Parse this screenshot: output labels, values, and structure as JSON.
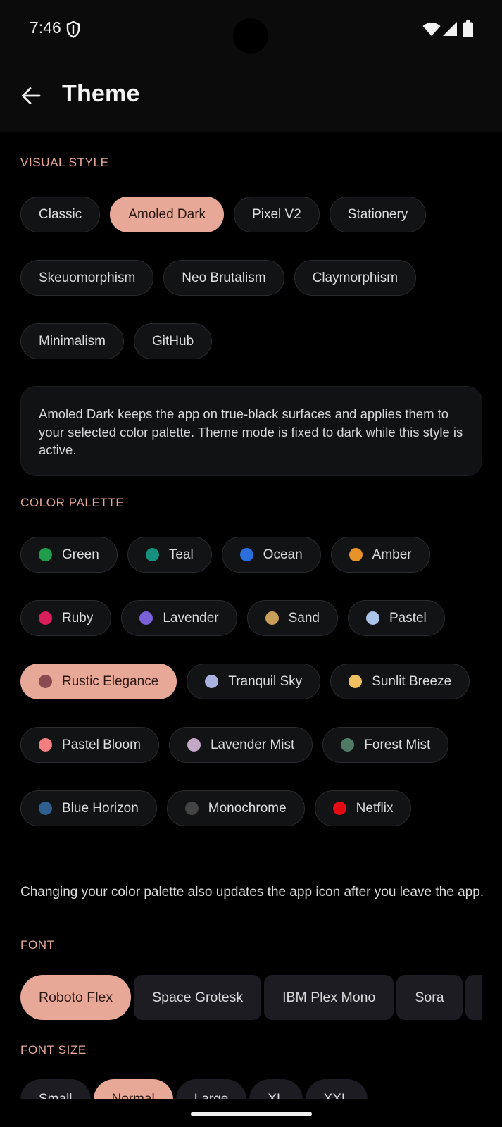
{
  "status": {
    "time": "7:46"
  },
  "header": {
    "title": "Theme"
  },
  "visual_style": {
    "label": "VISUAL STYLE",
    "rows": [
      [
        {
          "label": "Classic",
          "selected": false
        },
        {
          "label": "Amoled Dark",
          "selected": true
        },
        {
          "label": "Pixel V2",
          "selected": false
        },
        {
          "label": "Stationery",
          "selected": false
        }
      ],
      [
        {
          "label": "Skeuomorphism",
          "selected": false
        },
        {
          "label": "Neo Brutalism",
          "selected": false
        },
        {
          "label": "Claymorphism",
          "selected": false
        }
      ],
      [
        {
          "label": "Minimalism",
          "selected": false
        },
        {
          "label": "GitHub",
          "selected": false
        }
      ]
    ],
    "description": "Amoled Dark keeps the app on true-black surfaces and applies them to your selected color palette. Theme mode is fixed to dark while this style is active."
  },
  "color_palette": {
    "label": "COLOR PALETTE",
    "rows": [
      [
        {
          "label": "Green",
          "color": "#1e9e4a"
        },
        {
          "label": "Teal",
          "color": "#16907f"
        },
        {
          "label": "Ocean",
          "color": "#2a6fdb"
        },
        {
          "label": "Amber",
          "color": "#e8922a"
        }
      ],
      [
        {
          "label": "Ruby",
          "color": "#d81e5b"
        },
        {
          "label": "Lavender",
          "color": "#7b61d9"
        },
        {
          "label": "Sand",
          "color": "#c9a05a"
        },
        {
          "label": "Pastel",
          "color": "#aac4ea"
        }
      ],
      [
        {
          "label": "Rustic Elegance",
          "color": "#8a4a52",
          "selected": true
        },
        {
          "label": "Tranquil Sky",
          "color": "#aab0e0"
        },
        {
          "label": "Sunlit Breeze",
          "color": "#f0c060"
        }
      ],
      [
        {
          "label": "Pastel Bloom",
          "color": "#f28080"
        },
        {
          "label": "Lavender Mist",
          "color": "#c4a8c8"
        },
        {
          "label": "Forest Mist",
          "color": "#4e7a66"
        }
      ],
      [
        {
          "label": "Blue Horizon",
          "color": "#2f5f8e"
        },
        {
          "label": "Monochrome",
          "color": "#444444"
        },
        {
          "label": "Netflix",
          "color": "#e50914"
        }
      ]
    ],
    "note": "Changing your color palette also updates the app icon after you leave the app."
  },
  "font": {
    "label": "FONT",
    "options": [
      {
        "label": "Roboto Flex",
        "selected": true
      },
      {
        "label": "Space Grotesk",
        "selected": false
      },
      {
        "label": "IBM Plex Mono",
        "selected": false
      },
      {
        "label": "Sora",
        "selected": false
      },
      {
        "label": "",
        "selected": false
      }
    ]
  },
  "font_size": {
    "label": "FONT SIZE",
    "options": [
      {
        "label": "Small",
        "selected": false
      },
      {
        "label": "Normal",
        "selected": true
      },
      {
        "label": "Large",
        "selected": false
      },
      {
        "label": "XL",
        "selected": false
      },
      {
        "label": "XXL",
        "selected": false
      }
    ]
  },
  "accent": "#e8a898"
}
